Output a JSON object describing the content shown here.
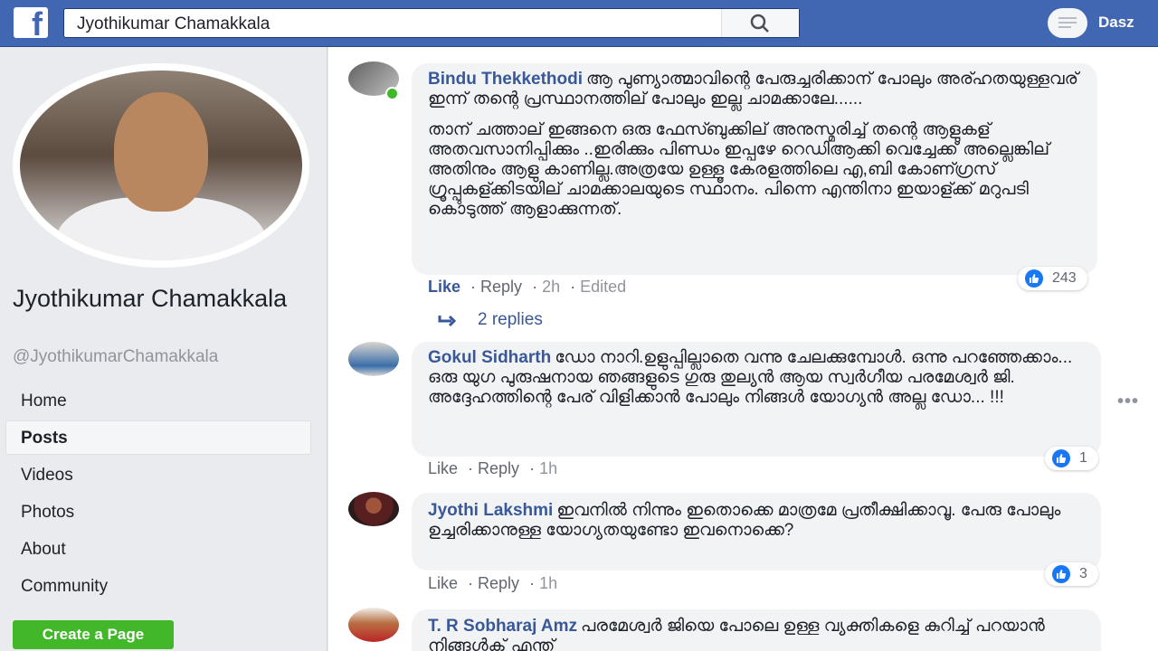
{
  "topbar": {
    "logo_letter": "f",
    "search_value": "Jyothikumar Chamakkala",
    "user_name": "Dasz"
  },
  "sidebar": {
    "name": "Jyothikumar Chamakkala",
    "handle": "@JyothikumarChamakkala",
    "nav": [
      "Home",
      "Posts",
      "Videos",
      "Photos",
      "About",
      "Community"
    ],
    "active_item": "Posts",
    "create_page_label": "Create a Page"
  },
  "comments": [
    {
      "author": "Bindu Thekkethodi",
      "text": "ആ പുണ്യാത്മാവിന്റെ പേരുച്ചരിക്കാന് പോലും അര്ഹതയുള്ളവര് ഇന്ന് തന്റെ പ്രസ്ഥാനത്തില് പോലും ഇല്ല ചാമക്കാലേ......",
      "text2": "താന് ചത്താല് ഇങ്ങനെ ഒരു ഫേസ്ബുക്കില് അനുസ്മരിച്ച് തന്റെ ആളുകള് അതവസാനിപ്പിക്കും ..ഇരിക്കും പിണ്ഡം ഇപ്പഴേ റെഡിആക്കി വെച്ചേക്ക് അല്ലെങ്കില് അതിനും ആളു കാണില്ല.അത്രയേ ഉള്ളൂ കേരളത്തിലെ എ,ബി കോണ്ഗ്രസ് ഗ്രൂപ്പുകള്ക്കിടയില് ചാമക്കാലയുടെ സ്ഥാനം. പിന്നെ എന്തിനാ ഇയാള്ക്ക് മറുപടി കൊടുത്ത് ആളാക്കുന്നത്.",
      "reactions": "243",
      "like": "Like",
      "reply": "Reply",
      "time": "2h",
      "edited": "Edited",
      "replies": "2 replies"
    },
    {
      "author": "Gokul Sidharth",
      "text": "ഡോ നാറി.ഉളുപ്പില്ലാതെ വന്നു ചേലക്കുമ്പോൾ. ഒന്നു പറഞ്ഞേക്കാം... ഒരു യുഗ പുരുഷനായ ഞങ്ങളുടെ ഗുരു തുല്യൻ ആയ സ്വർഗീയ പരമേശ്വർ ജി. അദ്ദേഹത്തിന്റെ പേര് വിളിക്കാൻ പോലും നിങ്ങൾ യോഗ്യൻ അല്ല ഡോ... !!!",
      "reactions": "1",
      "like": "Like",
      "reply": "Reply",
      "time": "1h"
    },
    {
      "author": "Jyothi Lakshmi",
      "text": "ഇവനിൽ നിന്നും ഇതൊക്കെ മാത്രമേ പ്രതീക്ഷിക്കാവൂ. പേരു പോലും ഉച്ചരിക്കാനുള്ള യോഗ്യതയുണ്ടോ ഇവനൊക്കെ?",
      "reactions": "3",
      "like": "Like",
      "reply": "Reply",
      "time": "1h"
    },
    {
      "author": "T. R Sobharaj Amz",
      "text": "പരമേശ്വർ ജിയെ പോലെ ഉള്ള വ്യക്തികളെ കുറിച്ച് പറയാൻ നിങ്ങൾക് എന്ത്"
    }
  ],
  "more_label": "•••",
  "colors": {
    "topbar": "#4267b2",
    "link": "#385898",
    "create_page": "#42b72a",
    "bubble": "#f2f3f5"
  }
}
